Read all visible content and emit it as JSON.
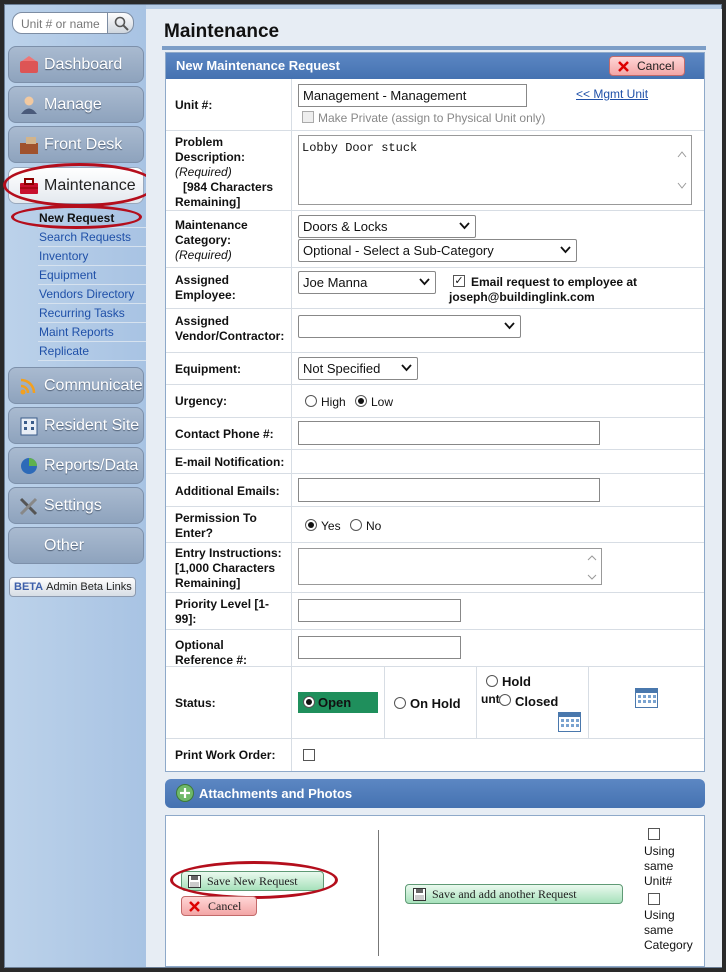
{
  "search": {
    "placeholder": "Unit # or name"
  },
  "nav": {
    "dashboard": "Dashboard",
    "manage": "Manage",
    "front_desk": "Front Desk",
    "maintenance": "Maintenance",
    "communicate": "Communicate",
    "resident_site": "Resident Site",
    "reports": "Reports/Data",
    "settings": "Settings",
    "other": "Other"
  },
  "subnav": [
    "New Request",
    "Search Requests",
    "Inventory",
    "Equipment",
    "Vendors Directory",
    "Recurring Tasks",
    "Maint Reports",
    "Replicate"
  ],
  "beta": {
    "badge": "BETA",
    "label": "Admin Beta Links"
  },
  "page": {
    "title": "Maintenance"
  },
  "form": {
    "header": "New Maintenance Request",
    "cancel": "Cancel",
    "unit": {
      "label": "Unit #:",
      "value": "Management - Management",
      "link": "<< Mgmt Unit",
      "private_label": "Make Private (assign to Physical Unit only)"
    },
    "problem": {
      "label1": "Problem",
      "label2": "Description:",
      "req": "(Required)",
      "chars": "[984 Characters",
      "chars2": "Remaining]",
      "value": "Lobby Door stuck"
    },
    "category": {
      "label1": "Maintenance",
      "label2": "Category:",
      "req": "(Required)",
      "value": "Doors & Locks",
      "sub_value": "Optional - Select a Sub-Category"
    },
    "employee": {
      "label1": "Assigned",
      "label2": "Employee:",
      "value": "Joe Manna",
      "email_label": "Email request to employee at",
      "email": "joseph@buildinglink.com"
    },
    "vendor": {
      "label1": "Assigned",
      "label2": "Vendor/Contractor:",
      "value": ""
    },
    "equipment": {
      "label": "Equipment:",
      "value": "Not Specified"
    },
    "urgency": {
      "label": "Urgency:",
      "high": "High",
      "low": "Low"
    },
    "phone": {
      "label": "Contact Phone #:",
      "value": ""
    },
    "email_notify": {
      "label": "E-mail Notification:"
    },
    "additional_emails": {
      "label": "Additional Emails:",
      "value": ""
    },
    "permission": {
      "label1": "Permission To",
      "label2": "Enter?",
      "yes": "Yes",
      "no": "No"
    },
    "entry": {
      "label1": "Entry Instructions:",
      "label2": "[1,000 Characters",
      "label3": "Remaining]",
      "value": ""
    },
    "priority": {
      "label1": "Priority Level [1-",
      "label2": "99]:",
      "value": ""
    },
    "reference": {
      "label1": "Optional",
      "label2": "Reference #:",
      "value": ""
    },
    "status": {
      "label": "Status:",
      "open": "Open",
      "on_hold": "On Hold",
      "hold_until": "Hold",
      "until_frag": "unt",
      "closed": "Closed"
    },
    "print": {
      "label": "Print Work Order:"
    }
  },
  "attachments": {
    "label": "Attachments and Photos"
  },
  "footer": {
    "save": "Save New Request",
    "cancel": "Cancel",
    "save_another": "Save and add another Request",
    "same_unit1": "Using",
    "same_unit2": "same",
    "same_unit3": "Unit#",
    "same_cat1": "Using",
    "same_cat2": "same",
    "same_cat3": "Category"
  },
  "colors": {
    "accent": "#4572b1",
    "status_open": "#1f8f5c",
    "highlight_ring": "#b40e1c"
  }
}
